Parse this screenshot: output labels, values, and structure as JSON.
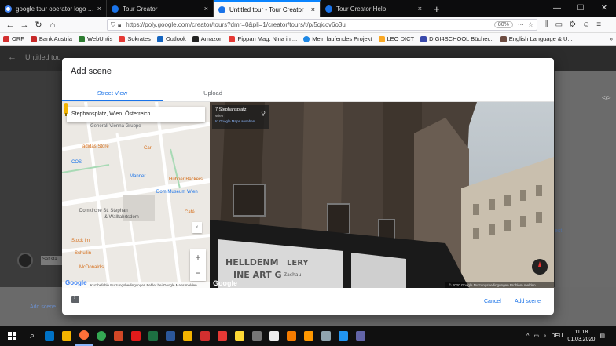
{
  "browser": {
    "tabs": [
      {
        "title": "google tour operator logo - Go",
        "color": "#ffffff",
        "active": false
      },
      {
        "title": "Tour Creator",
        "color": "#1a73e8",
        "active": false
      },
      {
        "title": "Untitled tour - Tour Creator",
        "color": "#1a73e8",
        "active": true
      },
      {
        "title": "Tour Creator Help",
        "color": "#1a73e8",
        "active": false
      }
    ],
    "url": "https://poly.google.com/creator/tours?dmr=0&pli=1/creator/tours/t/p/5qiccv6o3u",
    "zoom": "80%",
    "bookmarks": [
      {
        "label": "ORF",
        "color": "#d32f2f"
      },
      {
        "label": "Bank Austria",
        "color": "#c62828"
      },
      {
        "label": "WebUntis",
        "color": "#2e7d32"
      },
      {
        "label": "Sokrates",
        "color": "#e53935"
      },
      {
        "label": "Outlook",
        "color": "#1565c0"
      },
      {
        "label": "Amazon",
        "color": "#222222"
      },
      {
        "label": "Pippan Mag. Nina in ...",
        "color": "#e53935"
      },
      {
        "label": "Mein laufendes Projekt",
        "color": "#1e88e5"
      },
      {
        "label": "LEO DICT",
        "color": "#f9a825"
      },
      {
        "label": "DIGI4SCHOOL Bücher...",
        "color": "#3949ab"
      },
      {
        "label": "English Language & U...",
        "color": "#6d4c41"
      }
    ]
  },
  "page": {
    "title": "Untitled tou",
    "set_start": "Set sta",
    "add_scene_link": "Add scene",
    "rest_text": "est"
  },
  "modal": {
    "title": "Add scene",
    "tabs": [
      "Street View",
      "Upload"
    ],
    "search_value": "Stephansplatz, Wien, Österreich",
    "map_labels": {
      "generali": "Generali Vienna Gruppe",
      "adidas": "adidas Store",
      "cos": "COS",
      "carl": "Carl",
      "cafe": "Café",
      "manner": "Manner",
      "dom_museum": "Dom Museum Wien",
      "habiger": "Haas Haus",
      "dom": "Domkirche St. Stephan",
      "dom2": "& Wallfahrtsdom",
      "stock": "Stock im",
      "eisen": "Eisen-Platz",
      "schullin": "Schullin",
      "mcdonalds": "McDonald's",
      "huebner": "Hübner Backers",
      "ratschl": "Ratschl"
    },
    "map_footer": "Kurzbefehle  Nutzungsbedingungen  Fehler bei Google Maps melden",
    "map_logo": "Google",
    "sv_info_title": "7 Stephansplatz",
    "sv_info_city": "Wien",
    "sv_info_link": "In Google Maps ansehen",
    "sv_sign1": "HELLDENM",
    "sv_sign2": "LERY",
    "sv_sign3": "INE ART G",
    "sv_sign4": "Zachau",
    "sv_footer": "© 2020 Google   Nutzungsbedingungen   Problem melden",
    "sv_logo": "Google",
    "cancel_label": "Cancel",
    "add_label": "Add scene"
  },
  "taskbar": {
    "apps": [
      {
        "name": "search-icon",
        "color": "#ffffff"
      },
      {
        "name": "outlook-icon",
        "color": "#0072c6"
      },
      {
        "name": "file-explorer-icon",
        "color": "#f4b400"
      },
      {
        "name": "firefox-icon",
        "color": "#ff7139"
      },
      {
        "name": "chrome-icon",
        "color": "#34a853"
      },
      {
        "name": "powerpoint-icon",
        "color": "#d24726"
      },
      {
        "name": "acrobat-icon",
        "color": "#e21b1b"
      },
      {
        "name": "excel-icon",
        "color": "#1d6f42"
      },
      {
        "name": "word-icon",
        "color": "#2b579a"
      },
      {
        "name": "media-icon",
        "color": "#f4b400"
      },
      {
        "name": "swiss-icon",
        "color": "#d32f2f"
      },
      {
        "name": "gallery-icon",
        "color": "#e53935"
      },
      {
        "name": "notes-icon",
        "color": "#fdd835"
      },
      {
        "name": "calculator-icon",
        "color": "#777777"
      },
      {
        "name": "wordpad-icon",
        "color": "#eeeeee"
      },
      {
        "name": "kahoot-icon",
        "color": "#f57c00"
      },
      {
        "name": "paint-icon",
        "color": "#ff9800"
      },
      {
        "name": "tool-icon",
        "color": "#90a4ae"
      },
      {
        "name": "network-icon",
        "color": "#2196f3"
      },
      {
        "name": "teams-icon",
        "color": "#6264a7"
      }
    ],
    "language": "DEU",
    "time": "11:18",
    "date": "01.03.2020"
  }
}
